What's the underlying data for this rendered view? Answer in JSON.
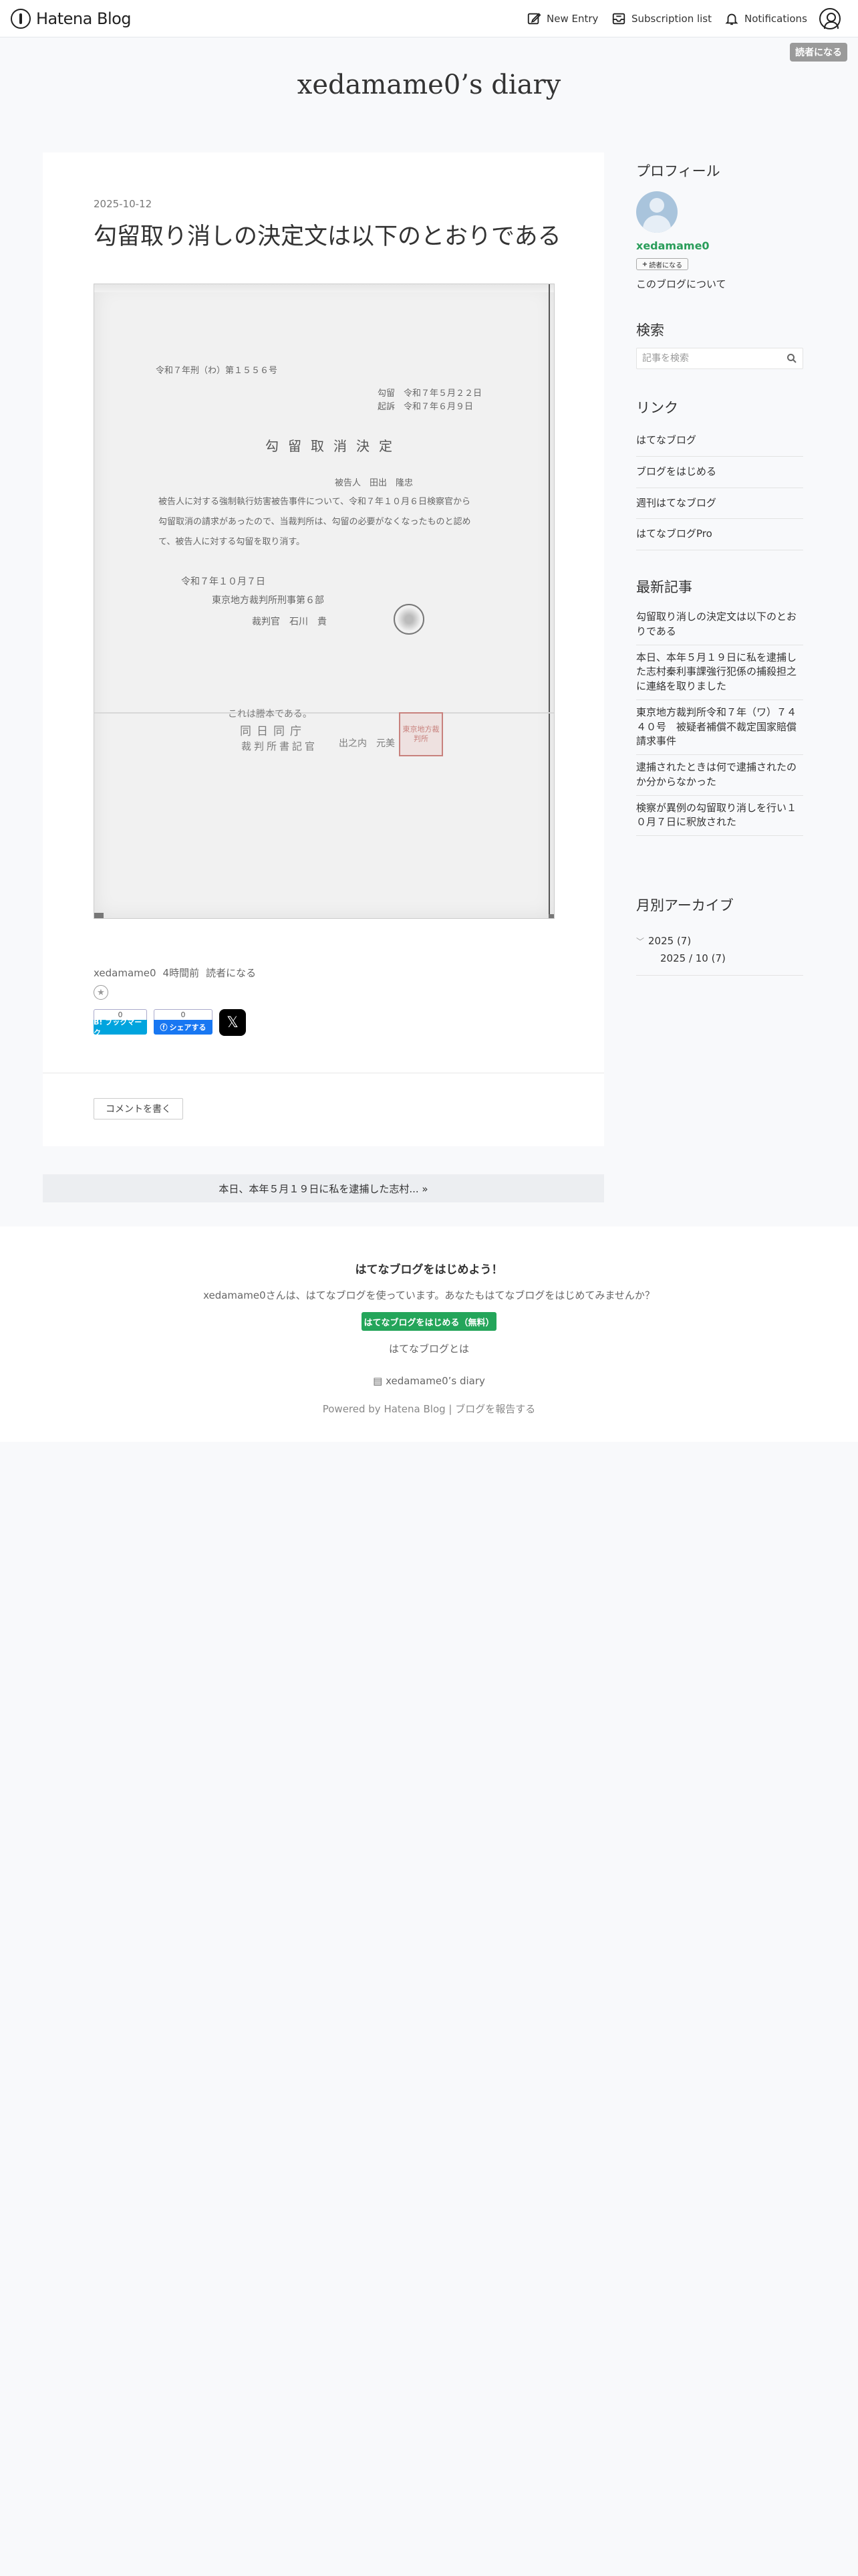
{
  "topbar": {
    "logo_text": "Hatena Blog",
    "new_entry": "New Entry",
    "subscription_list": "Subscription list",
    "notifications": "Notifications",
    "reader_button": "読者になる"
  },
  "blog": {
    "title": "xedamame0’s diary"
  },
  "entry": {
    "date": "2025-10-12",
    "title": "勾留取り消しの決定文は以下のとおりである",
    "document": {
      "case_no": "令和７年刑（わ）第１５５６号",
      "request_date": "勾留　令和７年５月２２日",
      "indict_date": "起訴　令和７年６月９日",
      "heading": "勾留取消決定",
      "defendant": "被告人　田出　隆忠",
      "body1": "被告人に対する強制執行妨害被告事件について、令和７年１０月６日検察官から",
      "body2": "勾留取消の請求があったので、当裁判所は、勾留の必要がなくなったものと認め",
      "body3": "て、被告人に対する勾留を取り消す。",
      "decision_date": "令和７年１０月７日",
      "court": "東京地方裁判所刑事第６部",
      "judge": "裁判官　石川　貴",
      "stamp1": "これは謄本である。",
      "stamp2": "同日同庁",
      "stamp3": "裁判所書記官",
      "stamp4": "出之内　元美",
      "red_seal": "東京地方裁判所"
    },
    "byline_author": "xedamame0",
    "byline_time": "4時間前",
    "byline_reader": "読者になる",
    "star_icon": "star-add-icon",
    "hatebu_count": "0",
    "hatebu_label": "B! ブックマーク",
    "fb_count": "0",
    "fb_label": "シェアする",
    "x_label": "𝕏",
    "comment_button": "コメントを書く"
  },
  "pager": {
    "next": "本日、本年５月１９日に私を逮捕した志村... »"
  },
  "sidebar": {
    "profile_heading": "プロフィール",
    "username": "xedamame0",
    "reader_button": "読者になる",
    "about_link": "このブログについて",
    "search_heading": "検索",
    "search_placeholder": "記事を検索",
    "links_heading": "リンク",
    "links": [
      "はてなブログ",
      "ブログをはじめる",
      "週刊はてなブログ",
      "はてなブログPro"
    ],
    "recent_heading": "最新記事",
    "recent": [
      "勾留取り消しの決定文は以下のとおりである",
      "本日、本年５月１９日に私を逮捕した志村秦利事課強行犯係の捕殺担之に連絡を取りました",
      "東京地方裁判所令和７年（ワ）７４４０号　被疑者補償不裁定国家賠償請求事件",
      "逮捕されたときは何で逮捕されたのか分からなかった",
      "検察が異例の勾留取り消しを行い１０月７日に釈放された"
    ],
    "archive_heading": "月別アーカイブ",
    "archive_year": "2025 (7)",
    "archive_month": "2025 / 10 (7)"
  },
  "footer": {
    "headline": "はてなブログをはじめよう！",
    "message": "xedamame0さんは、はてなブログを使っています。あなたもはてなブログをはじめてみませんか？",
    "start_button": "はてなブログをはじめる（無料）",
    "about": "はてなブログとは",
    "blog_link": "xedamame0’s diary",
    "powered": "Powered by Hatena Blog",
    "report": "ブログを報告する"
  }
}
